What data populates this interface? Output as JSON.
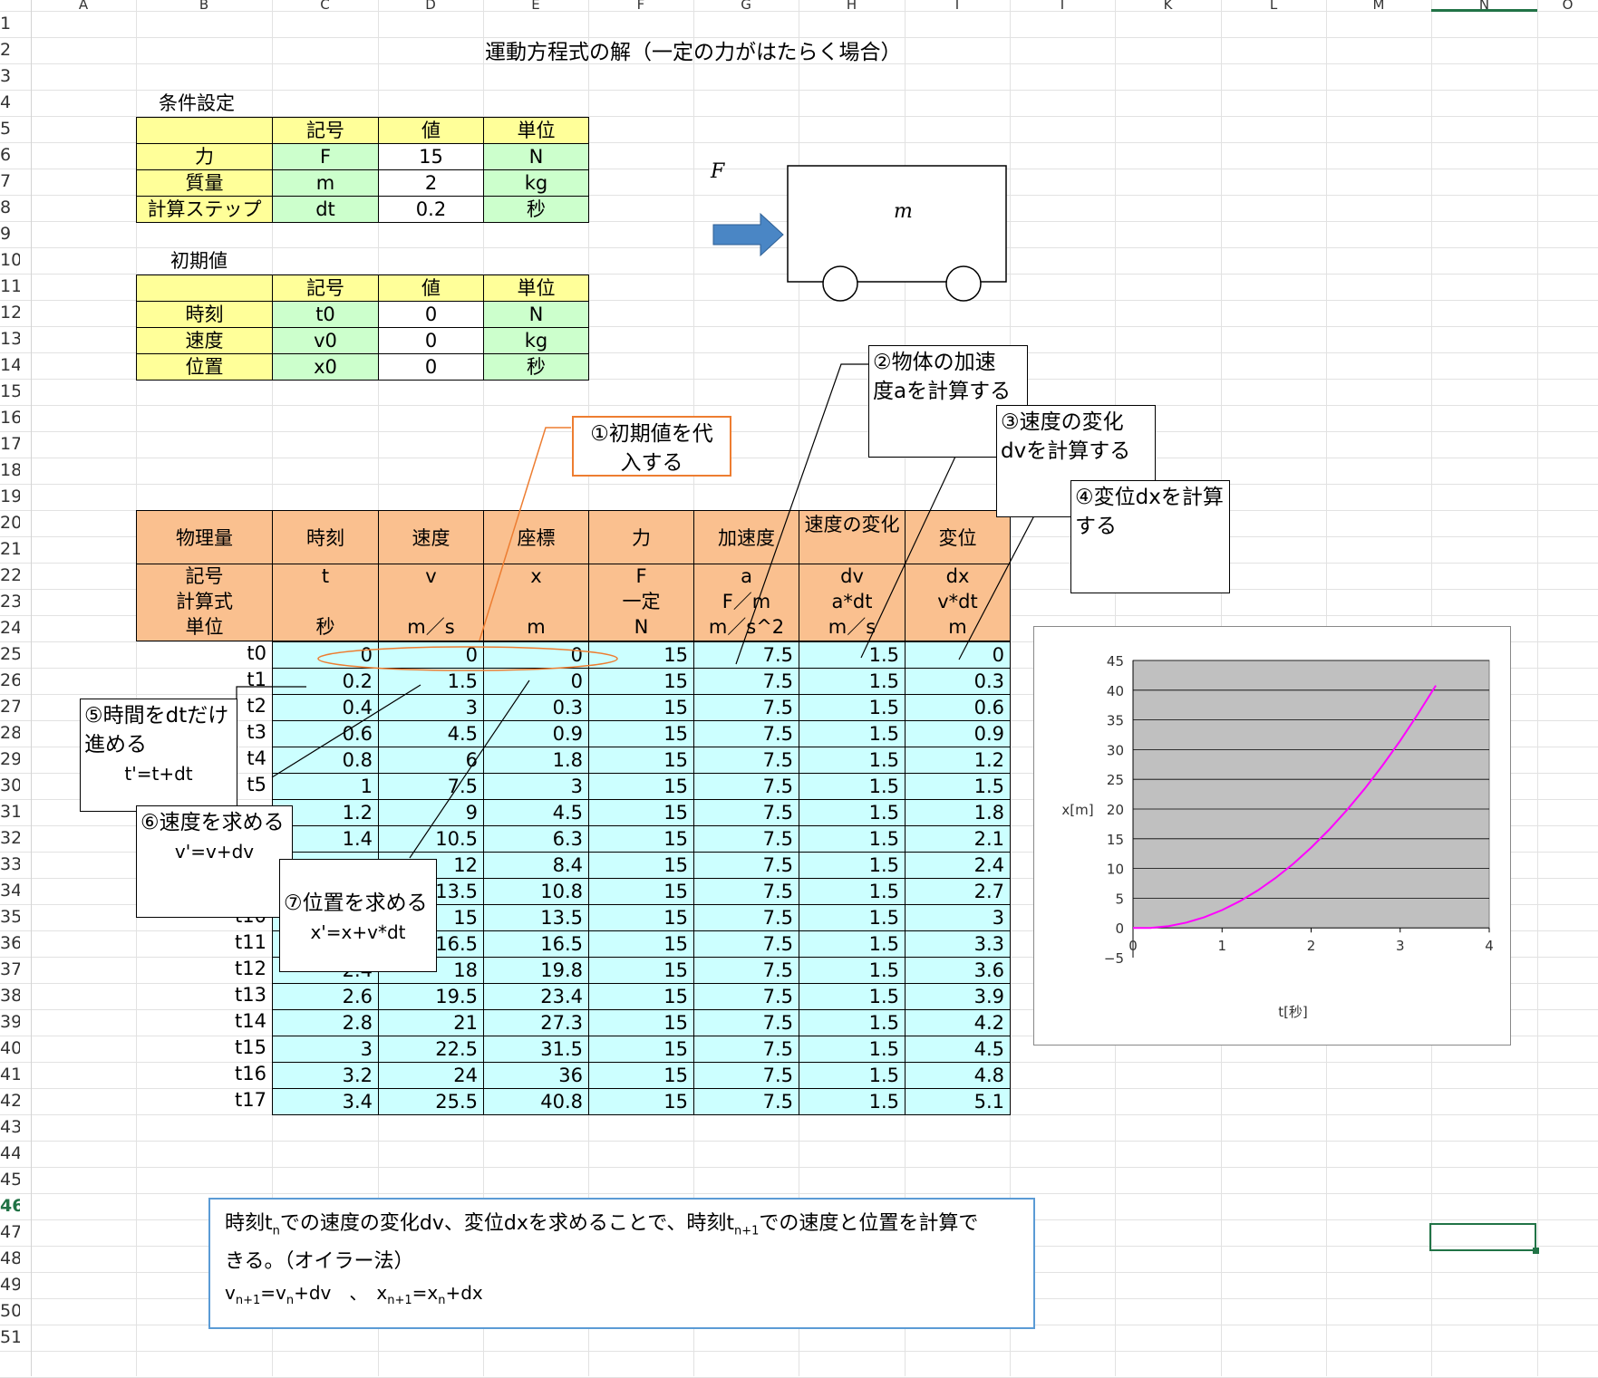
{
  "columns": [
    "A",
    "B",
    "C",
    "D",
    "E",
    "F",
    "G",
    "H",
    "I",
    "J",
    "K",
    "L",
    "M",
    "N",
    "O"
  ],
  "selected_column": "N",
  "selected_row": "46",
  "rows": [
    "1",
    "2",
    "3",
    "4",
    "5",
    "6",
    "7",
    "8",
    "9",
    "10",
    "11",
    "12",
    "13",
    "14",
    "15",
    "16",
    "17",
    "18",
    "19",
    "20",
    "21",
    "22",
    "23",
    "24",
    "25",
    "26",
    "27",
    "28",
    "29",
    "30",
    "31",
    "32",
    "33",
    "34",
    "35",
    "36",
    "37",
    "38",
    "39",
    "40",
    "41",
    "42",
    "43",
    "44",
    "45",
    "46",
    "47",
    "48",
    "49",
    "50",
    "51"
  ],
  "title": "運動方程式の解（一定の力がはたらく場合）",
  "conditions": {
    "heading": "条件設定",
    "headers": [
      "記号",
      "値",
      "単位"
    ],
    "rows": [
      {
        "label": "力",
        "symbol": "F",
        "value": "15",
        "unit": "N"
      },
      {
        "label": "質量",
        "symbol": "m",
        "value": "2",
        "unit": "kg"
      },
      {
        "label": "計算ステップ",
        "symbol": "dt",
        "value": "0.2",
        "unit": "秒"
      }
    ]
  },
  "initial": {
    "heading": "初期値",
    "headers": [
      "記号",
      "値",
      "単位"
    ],
    "rows": [
      {
        "label": "時刻",
        "symbol": "t0",
        "value": "0",
        "unit": "N"
      },
      {
        "label": "速度",
        "symbol": "v0",
        "value": "0",
        "unit": "kg"
      },
      {
        "label": "位置",
        "symbol": "x0",
        "value": "0",
        "unit": "秒"
      }
    ]
  },
  "diagram": {
    "force_label": "F",
    "mass_label": "m",
    "arrow_color": "#4a86c5"
  },
  "main_table": {
    "header_quantity": [
      "物理量",
      "時刻",
      "速度",
      "座標",
      "力",
      "加速度",
      "速度の変化",
      "変位"
    ],
    "header_symbol": [
      "記号",
      "t",
      "v",
      "x",
      "F",
      "a",
      "dv",
      "dx"
    ],
    "header_formula": [
      "計算式",
      "",
      "",
      "",
      "一定",
      "F／m",
      "a*dt",
      "v*dt"
    ],
    "header_unit": [
      "単位",
      "秒",
      "m／s",
      "m",
      "N",
      "m／s^2",
      "m／s",
      "m"
    ],
    "rows": [
      [
        "t0",
        "0",
        "0",
        "0",
        "15",
        "7.5",
        "1.5",
        "0"
      ],
      [
        "t1",
        "0.2",
        "1.5",
        "0",
        "15",
        "7.5",
        "1.5",
        "0.3"
      ],
      [
        "t2",
        "0.4",
        "3",
        "0.3",
        "15",
        "7.5",
        "1.5",
        "0.6"
      ],
      [
        "t3",
        "0.6",
        "4.5",
        "0.9",
        "15",
        "7.5",
        "1.5",
        "0.9"
      ],
      [
        "t4",
        "0.8",
        "6",
        "1.8",
        "15",
        "7.5",
        "1.5",
        "1.2"
      ],
      [
        "t5",
        "1",
        "7.5",
        "3",
        "15",
        "7.5",
        "1.5",
        "1.5"
      ],
      [
        "",
        "1.2",
        "9",
        "4.5",
        "15",
        "7.5",
        "1.5",
        "1.8"
      ],
      [
        "",
        "1.4",
        "10.5",
        "6.3",
        "15",
        "7.5",
        "1.5",
        "2.1"
      ],
      [
        "",
        "",
        "12",
        "8.4",
        "15",
        "7.5",
        "1.5",
        "2.4"
      ],
      [
        "",
        "",
        "13.5",
        "10.8",
        "15",
        "7.5",
        "1.5",
        "2.7"
      ],
      [
        "t10",
        "",
        "15",
        "13.5",
        "15",
        "7.5",
        "1.5",
        "3"
      ],
      [
        "t11",
        "",
        "16.5",
        "16.5",
        "15",
        "7.5",
        "1.5",
        "3.3"
      ],
      [
        "t12",
        "2.4",
        "18",
        "19.8",
        "15",
        "7.5",
        "1.5",
        "3.6"
      ],
      [
        "t13",
        "2.6",
        "19.5",
        "23.4",
        "15",
        "7.5",
        "1.5",
        "3.9"
      ],
      [
        "t14",
        "2.8",
        "21",
        "27.3",
        "15",
        "7.5",
        "1.5",
        "4.2"
      ],
      [
        "t15",
        "3",
        "22.5",
        "31.5",
        "15",
        "7.5",
        "1.5",
        "4.5"
      ],
      [
        "t16",
        "3.2",
        "24",
        "36",
        "15",
        "7.5",
        "1.5",
        "4.8"
      ],
      [
        "t17",
        "3.4",
        "25.5",
        "40.8",
        "15",
        "7.5",
        "1.5",
        "5.1"
      ]
    ]
  },
  "callouts": {
    "c1": [
      "①初期値を代",
      "入する"
    ],
    "c2": [
      "②物体の加速",
      "度aを計算する"
    ],
    "c3": [
      "③速度の変化",
      "dvを計算する"
    ],
    "c4": [
      "④変位dxを計算",
      "する"
    ],
    "c5": [
      "⑤時間をdtだけ",
      "進める",
      "t'=t+dt"
    ],
    "c6": [
      "⑥速度を求める",
      "v'=v+dv"
    ],
    "c7": [
      "⑦位置を求める",
      "x'=x+v*dt"
    ]
  },
  "summary": {
    "line1_a": "時刻t",
    "line1_sub1": "n",
    "line1_b": "での速度の変化dv、変位dxを求めることで、時刻t",
    "line1_sub2": "n+1",
    "line1_c": "での速度と位置を計算で",
    "line2": "きる。（オイラー法）",
    "f1_v": "v",
    "f1_sub1": "n+1",
    "f1_eq": "=v",
    "f1_sub2": "n",
    "f1_rest": "+dv　、　x",
    "f2_sub1": "n+1",
    "f2_eq": "=x",
    "f2_sub2": "n",
    "f2_rest": "+dx"
  },
  "chart_data": {
    "type": "line",
    "xlabel": "t[秒]",
    "ylabel": "x[m]",
    "xlim": [
      0,
      4
    ],
    "ylim": [
      -5,
      45
    ],
    "x_ticks": [
      "0",
      "1",
      "2",
      "3",
      "4"
    ],
    "y_ticks": [
      "45",
      "40",
      "35",
      "30",
      "25",
      "20",
      "15",
      "10",
      "5",
      "0",
      "−5"
    ],
    "grid": true,
    "plot_bg": "#c0c0c0",
    "line_color": "#ff00ff",
    "series": [
      {
        "x": [
          0,
          0.2,
          0.4,
          0.6,
          0.8,
          1,
          1.2,
          1.4,
          1.6,
          1.8,
          2,
          2.2,
          2.4,
          2.6,
          2.8,
          3,
          3.2,
          3.4
        ],
        "values": [
          0,
          0,
          0.3,
          0.9,
          1.8,
          3,
          4.5,
          6.3,
          8.4,
          10.8,
          13.5,
          16.5,
          19.8,
          23.4,
          27.3,
          31.5,
          36,
          40.8
        ]
      }
    ]
  }
}
